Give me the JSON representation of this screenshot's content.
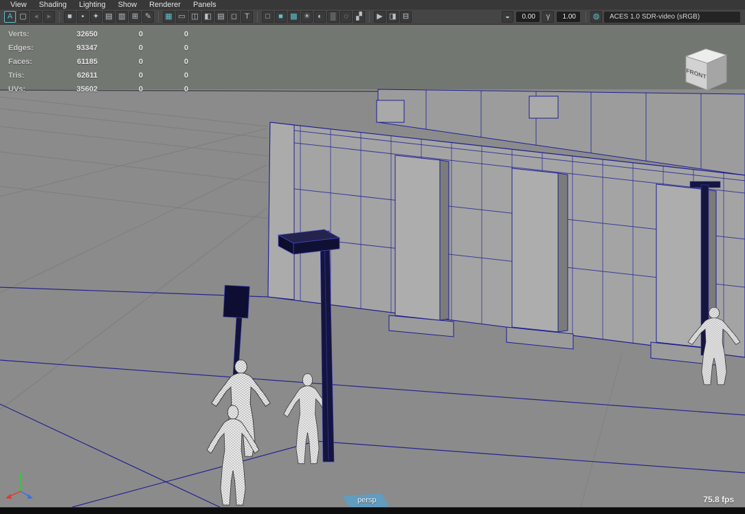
{
  "menu_bar": {
    "items": [
      "View",
      "Shading",
      "Lighting",
      "Show",
      "Renderer",
      "Panels"
    ]
  },
  "toolbar": {
    "icons": [
      {
        "name": "select-camera",
        "glyph": "A"
      },
      {
        "name": "selection-highlight",
        "glyph": "▢"
      },
      {
        "name": "camera-undo",
        "glyph": "◂"
      },
      {
        "name": "camera-redo",
        "glyph": "▸"
      },
      {
        "name": "camera",
        "glyph": "■"
      },
      {
        "name": "lock-camera",
        "glyph": "▪"
      },
      {
        "name": "camera-attributes",
        "glyph": "✦"
      },
      {
        "name": "bookmarks",
        "glyph": "▤"
      },
      {
        "name": "image-plane",
        "glyph": "▥"
      },
      {
        "name": "pan-zoom-2d",
        "glyph": "⊞"
      },
      {
        "name": "grease-pencil",
        "glyph": "✎"
      },
      {
        "name": "grid",
        "glyph": "▦"
      },
      {
        "name": "film-gate",
        "glyph": "▭"
      },
      {
        "name": "resolution-gate",
        "glyph": "◫"
      },
      {
        "name": "gate-mask",
        "glyph": "◧"
      },
      {
        "name": "field-chart",
        "glyph": "▤"
      },
      {
        "name": "safe-action",
        "glyph": "◻"
      },
      {
        "name": "safe-title",
        "glyph": "T"
      },
      {
        "name": "wireframe",
        "glyph": "□"
      },
      {
        "name": "smooth-shade",
        "glyph": "■"
      },
      {
        "name": "textured",
        "glyph": "▩"
      },
      {
        "name": "lights",
        "glyph": "☀"
      },
      {
        "name": "shadows",
        "glyph": "◐"
      },
      {
        "name": "ssao",
        "glyph": "▒"
      },
      {
        "name": "motion-blur",
        "glyph": "◌"
      },
      {
        "name": "anti-alias",
        "glyph": "▞"
      },
      {
        "name": "isolate-select",
        "glyph": "▶"
      },
      {
        "name": "xray",
        "glyph": "◨"
      },
      {
        "name": "xray-joints",
        "glyph": "⊟"
      },
      {
        "name": "exposure",
        "glyph": "◒"
      },
      {
        "name": "gamma",
        "glyph": "γ"
      },
      {
        "name": "view-transform",
        "glyph": "◍"
      }
    ],
    "exposure_value": "0.00",
    "gamma_value": "1.00",
    "color_space": "ACES 1.0 SDR-video (sRGB)"
  },
  "hud": {
    "stats": [
      {
        "label": "Verts:",
        "total": "32650",
        "sel1": "0",
        "sel2": "0"
      },
      {
        "label": "Edges:",
        "total": "93347",
        "sel1": "0",
        "sel2": "0"
      },
      {
        "label": "Faces:",
        "total": "61185",
        "sel1": "0",
        "sel2": "0"
      },
      {
        "label": "Tris:",
        "total": "62611",
        "sel1": "0",
        "sel2": "0"
      },
      {
        "label": "UVs:",
        "total": "35602",
        "sel1": "0",
        "sel2": "0"
      }
    ],
    "camera_label": "persp",
    "fps": "75.8 fps"
  },
  "view_cube": {
    "label": "FRONT"
  }
}
